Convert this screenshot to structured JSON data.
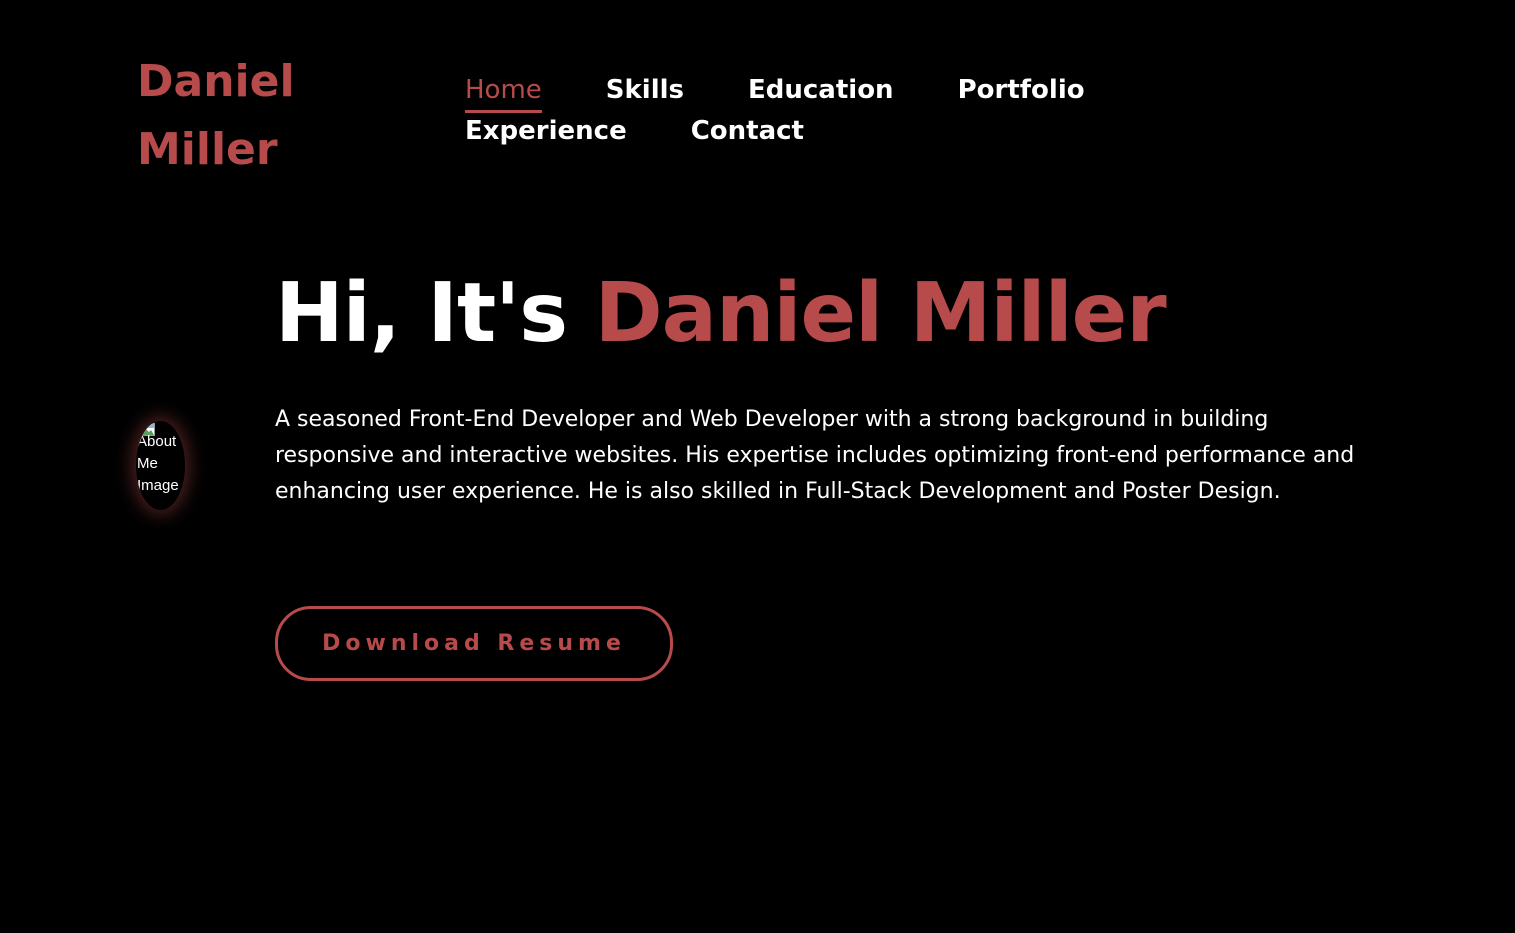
{
  "brand": {
    "first_name": "Daniel",
    "last_name": "Miller",
    "accent_color": "#b74b4b",
    "background_color": "#000000",
    "text_color": "#ffffff"
  },
  "nav": {
    "items": [
      {
        "label": "Home",
        "active": true
      },
      {
        "label": "Skills",
        "active": false
      },
      {
        "label": "Education",
        "active": false
      },
      {
        "label": "Portfolio",
        "active": false
      },
      {
        "label": "Experience",
        "active": false
      },
      {
        "label": "Contact",
        "active": false
      }
    ]
  },
  "avatar": {
    "alt_text": "About Me Image",
    "icon": "broken-image-icon"
  },
  "hero": {
    "greeting": "Hi, It's ",
    "name": "Daniel Miller",
    "description": "A seasoned Front-End Developer and Web Developer with a strong background in building responsive and interactive websites. His expertise includes optimizing front-end performance and enhancing user experience. He is also skilled in Full-Stack Development and Poster Design.",
    "cta_label": "Download Resume"
  }
}
